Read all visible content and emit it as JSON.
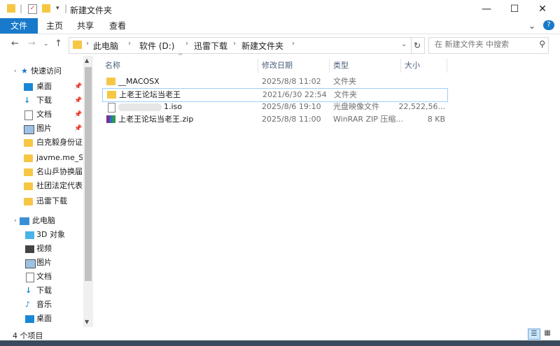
{
  "window": {
    "title": "新建文件夹",
    "minimize_glyph": "—",
    "maximize_glyph": "☐",
    "close_glyph": "✕"
  },
  "ribbon": {
    "tabs": [
      {
        "label": "文件"
      },
      {
        "label": "主页"
      },
      {
        "label": "共享"
      },
      {
        "label": "查看"
      }
    ],
    "collapse_glyph": "⌄",
    "help_glyph": "?"
  },
  "address": {
    "crumbs": [
      "此电脑",
      "软件 (D:)",
      "迅雷下载",
      "新建文件夹"
    ],
    "search_placeholder": "在 新建文件夹 中搜索"
  },
  "nav": {
    "quick_access_label": "快速访问",
    "quick_items": [
      {
        "label": "桌面",
        "icon": "desktop-icon",
        "pinned": true
      },
      {
        "label": "下载",
        "icon": "download-icon",
        "pinned": true
      },
      {
        "label": "文档",
        "icon": "document-icon",
        "pinned": true
      },
      {
        "label": "图片",
        "icon": "picture-icon",
        "pinned": true
      },
      {
        "label": "白克毅身份证",
        "icon": "folder-icon",
        "pinned": true
      },
      {
        "label": "javme.me_SM",
        "icon": "folder-icon",
        "pinned": false
      },
      {
        "label": "名山乒协换届",
        "icon": "folder-icon",
        "pinned": false
      },
      {
        "label": "社团法定代表人",
        "icon": "folder-icon",
        "pinned": false
      },
      {
        "label": "迅雷下载",
        "icon": "folder-icon",
        "pinned": false
      }
    ],
    "this_pc_label": "此电脑",
    "pc_items": [
      {
        "label": "3D 对象",
        "icon": "3d-objects-icon"
      },
      {
        "label": "视频",
        "icon": "video-icon"
      },
      {
        "label": "图片",
        "icon": "picture-icon"
      },
      {
        "label": "文档",
        "icon": "document-icon"
      },
      {
        "label": "下载",
        "icon": "download-icon"
      },
      {
        "label": "音乐",
        "icon": "music-icon"
      },
      {
        "label": "桌面",
        "icon": "desktop-icon"
      }
    ]
  },
  "columns": {
    "name": "名称",
    "date": "修改日期",
    "type": "类型",
    "size": "大小"
  },
  "files": [
    {
      "name": "__MACOSX",
      "date": "2025/8/8 11:02",
      "type": "文件夹",
      "size": "",
      "icon": "folder-icon"
    },
    {
      "name": "上老王论坛当老王",
      "date": "2021/6/30 22:54",
      "type": "文件夹",
      "size": "",
      "icon": "folder-icon"
    },
    {
      "name": "1.iso",
      "date": "2025/8/6 19:10",
      "type": "光盘映像文件",
      "size": "22,522,56...",
      "icon": "disc-image-icon"
    },
    {
      "name": "上老王论坛当老王.zip",
      "date": "2025/8/8 11:00",
      "type": "WinRAR ZIP 压缩...",
      "size": "8 KB",
      "icon": "winrar-icon"
    }
  ],
  "status": {
    "item_count": "4 个项目"
  },
  "colors": {
    "accent": "#1979ca",
    "selection_border": "#99d1ff",
    "folder": "#f6c744"
  }
}
